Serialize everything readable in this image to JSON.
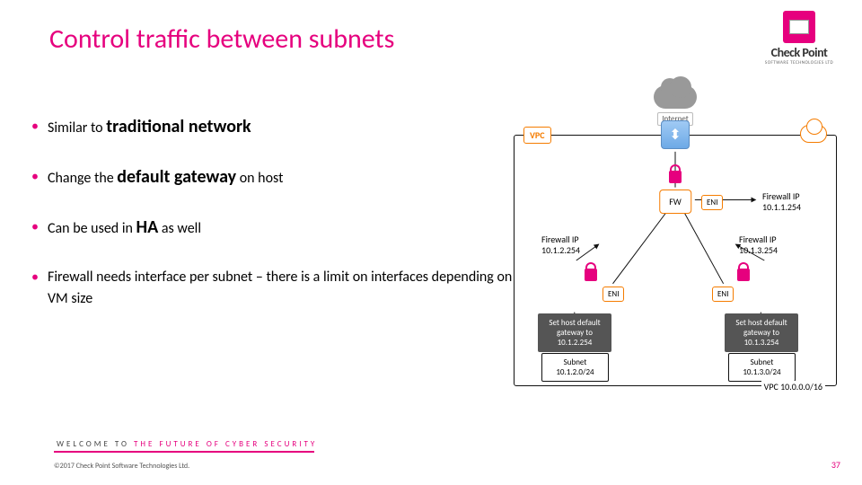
{
  "title": "Control traffic between subnets",
  "logo": {
    "name": "Check Point",
    "sub": "SOFTWARE TECHNOLOGIES LTD"
  },
  "bullets": [
    {
      "pre": "Similar to ",
      "bold": "traditional network",
      "post": ""
    },
    {
      "pre": "Change the ",
      "bold": "default gateway",
      "post": " on host"
    },
    {
      "pre": "Can be used in ",
      "bold": "HA",
      "post": " as well"
    },
    {
      "pre": "Firewall needs interface per subnet – there is a limit on interfaces depending on VM size",
      "bold": "",
      "post": ""
    }
  ],
  "diagram": {
    "internet": "Internet",
    "vpc_label": "VPC",
    "fw": "FW",
    "eni": "ENI",
    "fwip": [
      {
        "label": "Firewall IP",
        "ip": "10.1.1.254"
      },
      {
        "label": "Firewall IP",
        "ip": "10.1.2.254"
      },
      {
        "label": "Firewall IP",
        "ip": "10.1.3.254"
      }
    ],
    "gwbox": [
      "Set host default gateway to 10.1.2.254",
      "Set host default gateway to 10.1.3.254"
    ],
    "subnet": [
      {
        "name": "Subnet",
        "cidr": "10.1.2.0/24"
      },
      {
        "name": "Subnet",
        "cidr": "10.1.3.0/24"
      }
    ],
    "vpc_cidr": "VPC 10.0.0.0/16"
  },
  "footer": {
    "tag_a": "WELCOME TO ",
    "tag_b": "THE FUTURE OF CYBER SECURITY",
    "copyright": "©2017 Check Point Software Technologies Ltd.",
    "page": "37"
  }
}
